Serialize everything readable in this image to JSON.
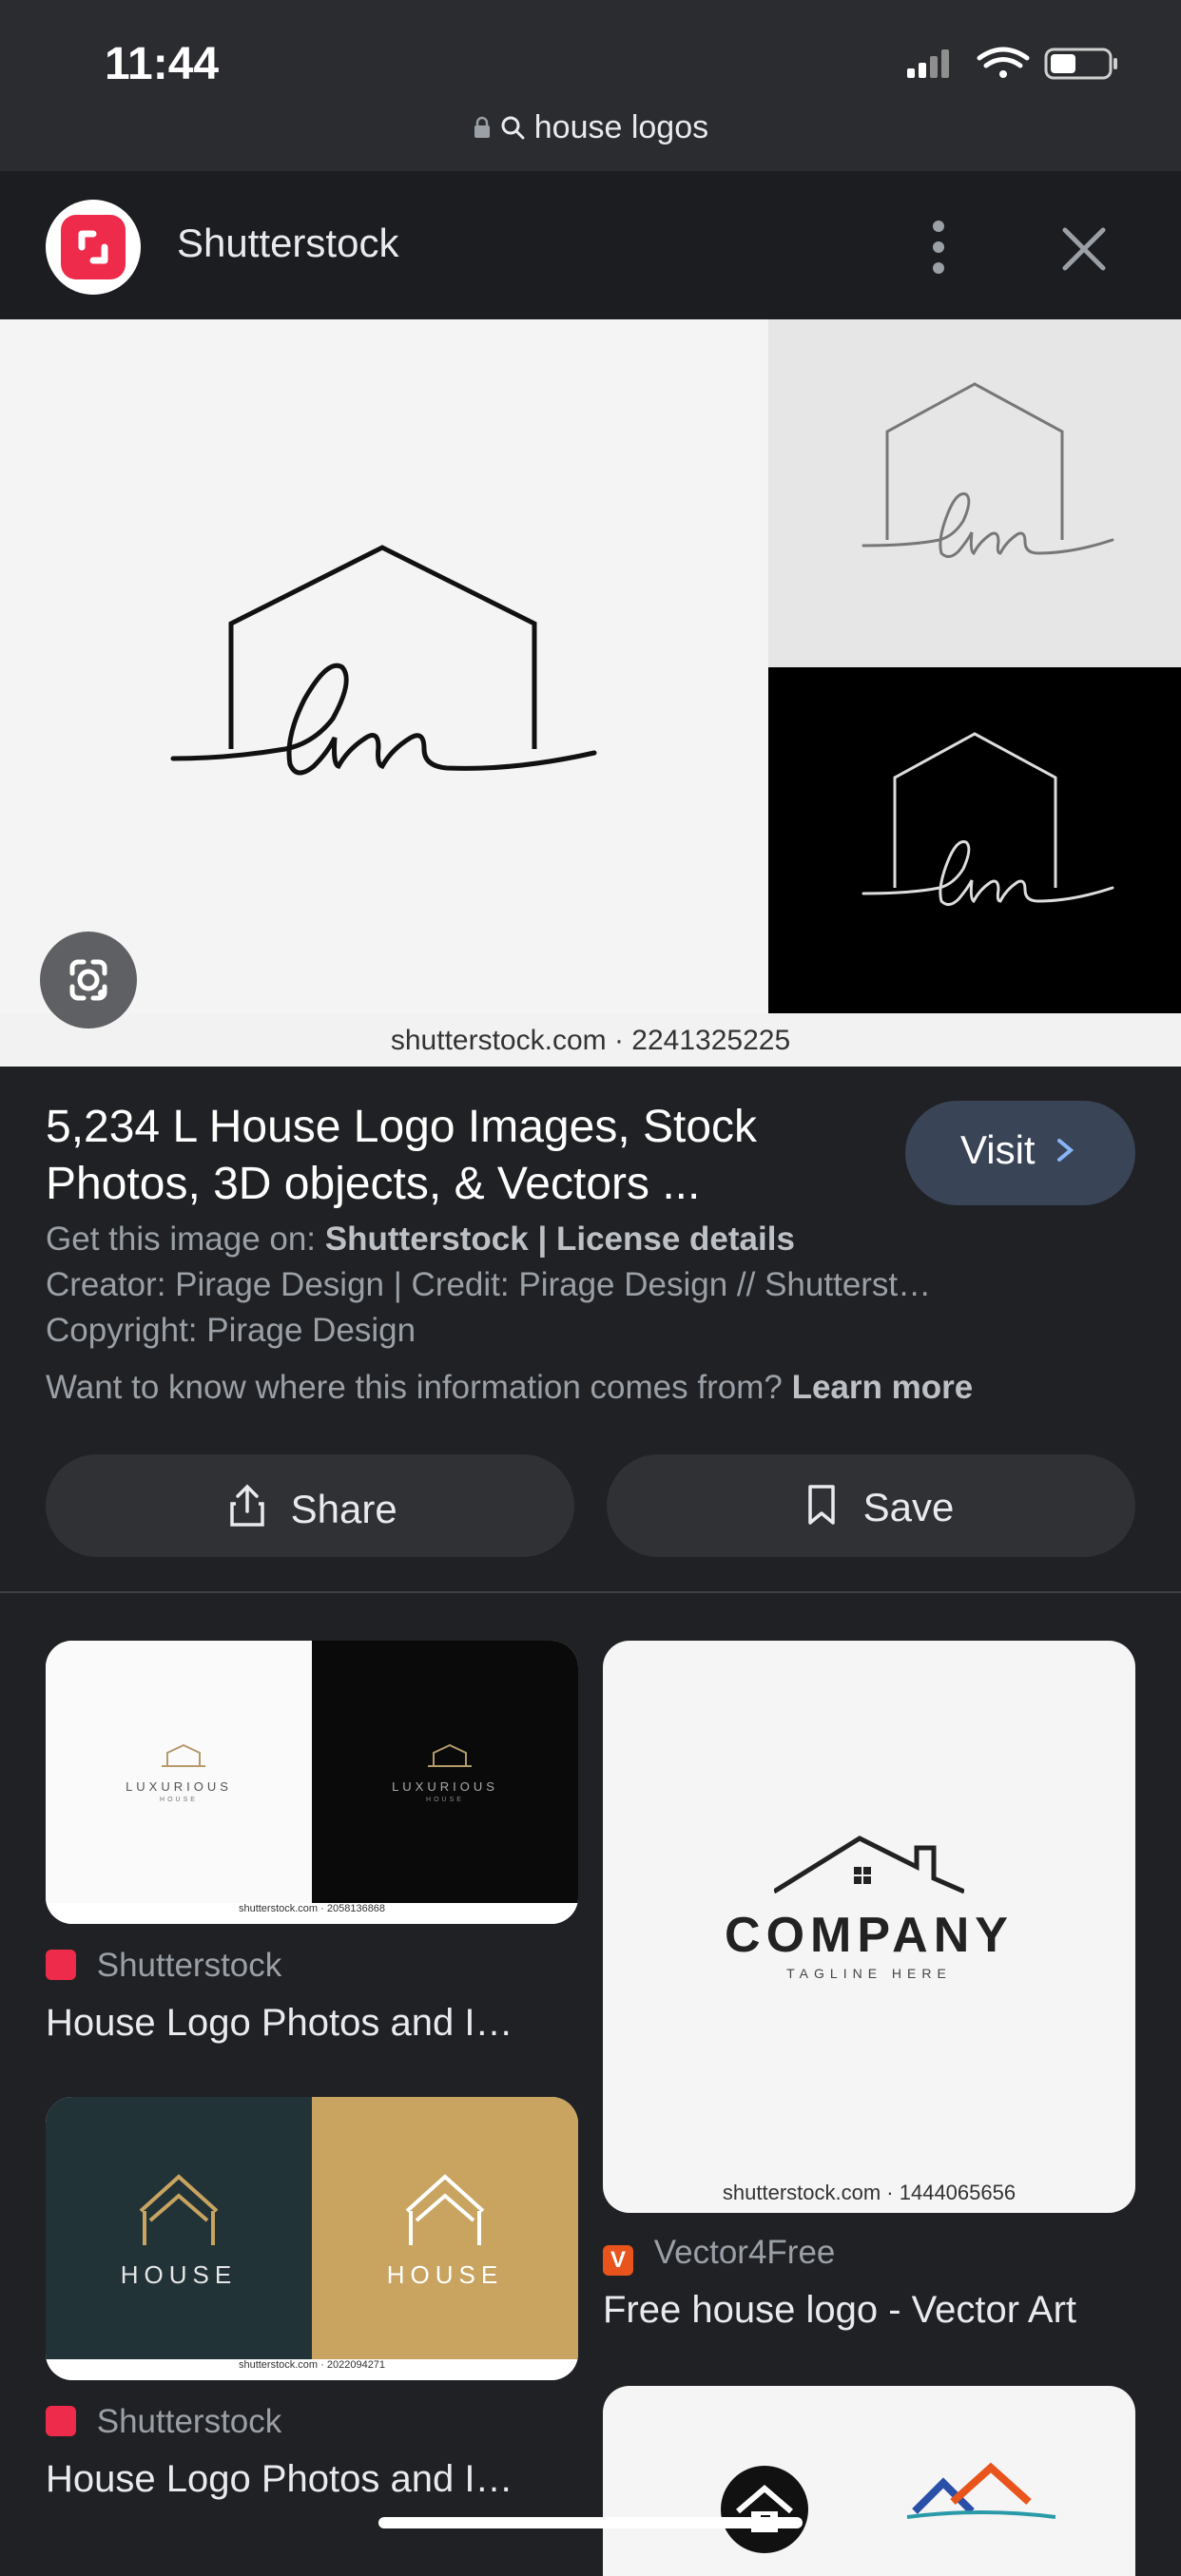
{
  "status_bar": {
    "time": "11:44"
  },
  "url_bar": {
    "query": "house logos"
  },
  "header": {
    "site_name": "Shutterstock"
  },
  "hero": {
    "watermark": "shutterstock.com · 2241325225",
    "logo_text": "lm"
  },
  "result": {
    "title": "5,234 L House Logo Images, Stock Photos, 3D objects, & Vectors ...",
    "visit_label": "Visit",
    "get_image_prefix": "Get this image on:",
    "get_image_source": "Shutterstock",
    "separator": "|",
    "license_link": "License details",
    "creator_line": "Creator: Pirage Design | Credit: Pirage Design // Shutterst…",
    "copyright_line": "Copyright: Pirage Design",
    "info_question": "Want to know where this information comes from?",
    "learn_more": "Learn more"
  },
  "actions": {
    "share_label": "Share",
    "save_label": "Save"
  },
  "related": [
    {
      "source": "Shutterstock",
      "title": "House Logo Photos and I…",
      "image_text": "LUXURIOUS",
      "image_subtext": "HOUSE",
      "watermark": "shutterstock.com · 2058136868"
    },
    {
      "source": "Vector4Free",
      "title": "Free house logo - Vector Art",
      "image_text": "COMPANY",
      "image_subtext": "TAGLINE HERE",
      "watermark": "shutterstock.com · 1444065656"
    },
    {
      "source": "Shutterstock",
      "title": "House Logo Photos and I…",
      "image_text": "HOUSE",
      "watermark": "shutterstock.com · 2022094271"
    }
  ],
  "colors": {
    "background": "#202124",
    "visit_button": "#394457",
    "shutterstock_red": "#ee2b4a",
    "vector4free_orange": "#e8541c"
  }
}
